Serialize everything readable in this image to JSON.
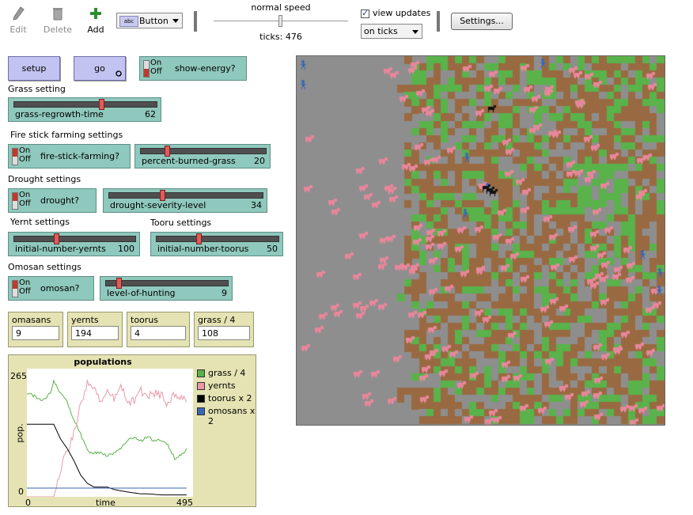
{
  "toolbar": {
    "edit_label": "Edit",
    "delete_label": "Delete",
    "add_label": "Add",
    "widget_type": "Button",
    "widget_chip": "abc",
    "speed_label": "normal speed",
    "ticks_text": "ticks: 476",
    "view_updates_label": "view updates",
    "view_updates_checked": true,
    "update_mode": "on ticks",
    "settings_label": "Settings..."
  },
  "controls": {
    "setup_label": "setup",
    "go_label": "go",
    "go_icon": "forever-icon",
    "switch_on": "On",
    "switch_off": "Off",
    "show_energy_label": "show-energy?",
    "grass_setting_note": "Grass setting",
    "grass_regrowth": {
      "name": "grass-regrowth-time",
      "value": "62",
      "fraction": 0.62
    },
    "fire_note": "Fire stick farming settings",
    "fire_switch_label": "fire-stick-farming?",
    "percent_burned": {
      "name": "percent-burned-grass",
      "value": "20",
      "fraction": 0.2
    },
    "drought_note": "Drought settings",
    "drought_switch_label": "drought?",
    "drought_level": {
      "name": "drought-severity-level",
      "value": "34",
      "fraction": 0.34
    },
    "yernt_note": "Yernt settings",
    "toorus_note": "Tooru settings",
    "initial_yernts": {
      "name": "initial-number-yernts",
      "value": "100",
      "fraction": 0.34
    },
    "initial_toorus": {
      "name": "initial-number-toorus",
      "value": "50",
      "fraction": 0.34
    },
    "omosan_note": "Omosan settings",
    "omosan_switch_label": "omosan?",
    "hunting": {
      "name": "level-of-hunting",
      "value": "9",
      "fraction": 0.09
    }
  },
  "monitors": [
    {
      "label": "omasans",
      "value": "9"
    },
    {
      "label": "yernts",
      "value": "194"
    },
    {
      "label": "toorus",
      "value": "4"
    },
    {
      "label": "grass / 4",
      "value": "108"
    }
  ],
  "chart_data": {
    "type": "line",
    "title": "populations",
    "xlabel": "time",
    "ylabel": "pop.",
    "xlim": [
      0,
      495
    ],
    "ylim": [
      0,
      265
    ],
    "x_tick_labels": [
      "0",
      "495"
    ],
    "y_tick_labels": [
      "0",
      "265"
    ],
    "legend_position": "right",
    "series": [
      {
        "name": "grass / 4",
        "color": "#59b24a",
        "x": [
          0,
          30,
          50,
          70,
          80,
          100,
          120,
          140,
          160,
          180,
          200,
          220,
          240,
          260,
          280,
          300,
          320,
          340,
          360,
          380,
          400,
          420,
          440,
          470,
          476
        ],
        "y": [
          215,
          205,
          200,
          215,
          240,
          215,
          195,
          160,
          130,
          95,
          90,
          90,
          85,
          90,
          100,
          115,
          125,
          115,
          125,
          115,
          118,
          107,
          80,
          90,
          100
        ]
      },
      {
        "name": "yernts",
        "color": "#e89aa8",
        "x": [
          0,
          80,
          95,
          110,
          120,
          140,
          160,
          180,
          200,
          220,
          240,
          260,
          280,
          300,
          320,
          340,
          360,
          380,
          400,
          420,
          440,
          460,
          476
        ],
        "y": [
          0,
          0,
          45,
          80,
          90,
          130,
          190,
          235,
          225,
          200,
          220,
          200,
          230,
          195,
          200,
          220,
          205,
          215,
          210,
          190,
          215,
          205,
          195
        ]
      },
      {
        "name": "toorus x 2",
        "color": "#000000",
        "x": [
          0,
          80,
          100,
          120,
          140,
          160,
          180,
          200,
          240,
          260,
          300,
          340,
          360,
          400,
          440,
          476
        ],
        "y": [
          150,
          150,
          120,
          100,
          75,
          45,
          28,
          20,
          20,
          15,
          10,
          6,
          6,
          4,
          4,
          4
        ]
      },
      {
        "name": "omosans x 2",
        "color": "#3a66b4",
        "x": [
          0,
          476
        ],
        "y": [
          18,
          18
        ]
      }
    ]
  },
  "world": {
    "colors": {
      "grass": "#59b24a",
      "dirt": "#996a42",
      "empty": "#8e8e8e",
      "yernt": "#e8869b",
      "omosan": "#3a66b4",
      "tooru": "#111111"
    },
    "yernt_count": 194,
    "omosan_count": 9,
    "tooru_count": 4
  }
}
